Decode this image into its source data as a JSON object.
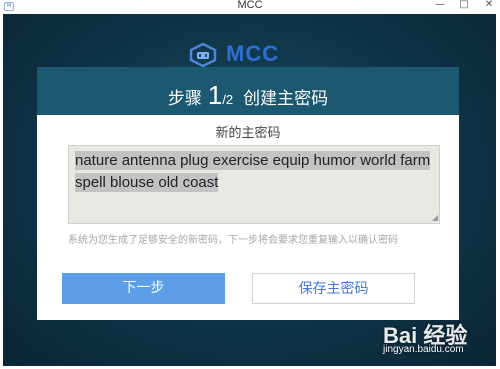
{
  "window": {
    "title": "MCC",
    "app_icon": "mcc-app-icon",
    "controls": {
      "minimize": "—",
      "maximize": "□",
      "close": "✕"
    }
  },
  "brand": {
    "logo_text": "MCC",
    "logo_icon": "mcc-logo-icon",
    "accent_color": "#2e6fd0"
  },
  "dialog": {
    "step_prefix": "步骤",
    "step_current": "1",
    "step_total": "/2",
    "step_title": "创建主密码",
    "section_label": "新的主密码",
    "passphrase": "nature antenna plug exercise equip humor world farm spell blouse old coast",
    "hint": "系统为您生成了足够安全的新密码，下一步将会要求您重复输入以确认密码",
    "next_button": "下一步",
    "save_button": "保存主密码",
    "header_color": "#1c5870",
    "primary_color": "#5c9ee8"
  },
  "watermark": {
    "logo": "Bai 经验",
    "url": "jingyan.baidu.com"
  }
}
